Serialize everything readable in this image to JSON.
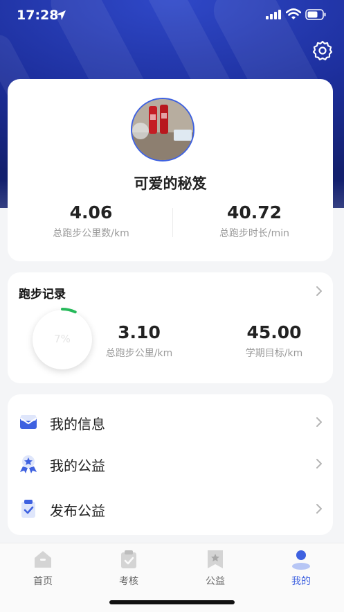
{
  "status_bar": {
    "time": "17:28"
  },
  "profile": {
    "username": "可爱的秘笈",
    "total_distance": "4.06",
    "total_distance_label": "总跑步公里数/km",
    "total_duration": "40.72",
    "total_duration_label": "总跑步时长/min"
  },
  "running_record": {
    "title": "跑步记录",
    "progress_percent": 7,
    "progress_text": "7%",
    "total_km": "3.10",
    "total_km_label": "总跑步公里/km",
    "term_goal": "45.00",
    "term_goal_label": "学期目标/km"
  },
  "menu": {
    "items": [
      {
        "label": "我的信息",
        "icon": "envelope-icon"
      },
      {
        "label": "我的公益",
        "icon": "medal-icon"
      },
      {
        "label": "发布公益",
        "icon": "clipboard-check-icon"
      }
    ]
  },
  "tabbar": {
    "tabs": [
      {
        "label": "首页",
        "icon": "home-icon"
      },
      {
        "label": "考核",
        "icon": "clipboard-icon"
      },
      {
        "label": "公益",
        "icon": "bookmark-star-icon"
      },
      {
        "label": "我的",
        "icon": "user-icon",
        "active": true
      }
    ]
  },
  "colors": {
    "accent": "#3e61e0",
    "progress": "#26b95a",
    "hero": "#1d2f9d"
  }
}
